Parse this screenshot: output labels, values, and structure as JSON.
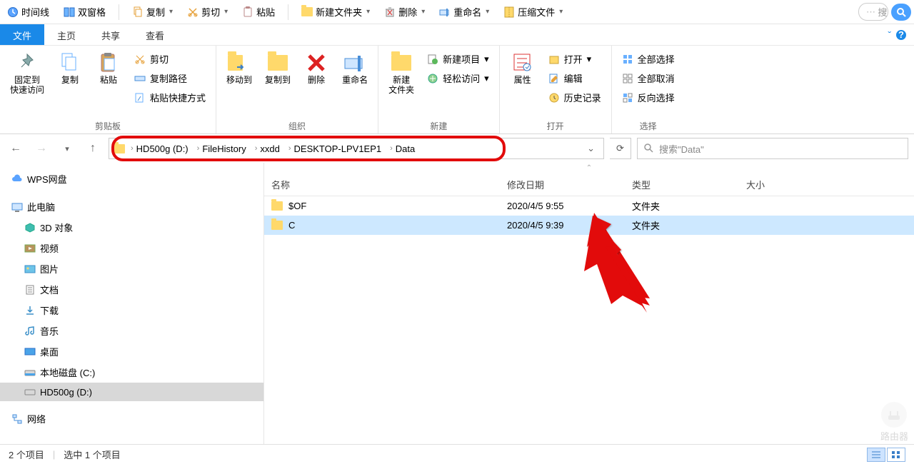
{
  "top_strip": {
    "timeline": "时间线",
    "dual_pane": "双窗格",
    "copy": "复制",
    "cut": "剪切",
    "paste": "粘贴",
    "new_folder": "新建文件夹",
    "delete": "删除",
    "rename": "重命名",
    "compress": "压缩文件",
    "search_placeholder": "搜"
  },
  "tabs": {
    "file": "文件",
    "home": "主页",
    "share": "共享",
    "view": "查看"
  },
  "ribbon": {
    "pin": "固定到\n快速访问",
    "copy": "复制",
    "paste": "粘贴",
    "cut": "剪切",
    "copy_path": "复制路径",
    "paste_shortcut": "粘贴快捷方式",
    "group_clipboard": "剪贴板",
    "move_to": "移动到",
    "copy_to": "复制到",
    "delete": "删除",
    "rename": "重命名",
    "group_organize": "组织",
    "new_folder": "新建\n文件夹",
    "new_item": "新建项目",
    "easy_access": "轻松访问",
    "group_new": "新建",
    "properties": "属性",
    "open": "打开",
    "edit": "编辑",
    "history": "历史记录",
    "group_open": "打开",
    "select_all": "全部选择",
    "select_none": "全部取消",
    "invert": "反向选择",
    "group_select": "选择"
  },
  "breadcrumbs": [
    "HD500g (D:)",
    "FileHistory",
    "xxdd",
    "DESKTOP-LPV1EP1",
    "Data"
  ],
  "search_placeholder": "搜索\"Data\"",
  "sidebar": {
    "wps": "WPS网盘",
    "this_pc": "此电脑",
    "items": [
      "3D 对象",
      "视频",
      "图片",
      "文档",
      "下载",
      "音乐",
      "桌面",
      "本地磁盘 (C:)",
      "HD500g (D:)"
    ],
    "network": "网络"
  },
  "columns": {
    "name": "名称",
    "date": "修改日期",
    "type": "类型",
    "size": "大小"
  },
  "rows": [
    {
      "name": "$OF",
      "date": "2020/4/5 9:55",
      "type": "文件夹",
      "size": ""
    },
    {
      "name": "C",
      "date": "2020/4/5 9:39",
      "type": "文件夹",
      "size": ""
    }
  ],
  "status": {
    "count": "2 个项目",
    "selected": "选中 1 个项目"
  },
  "watermark": "路由器"
}
